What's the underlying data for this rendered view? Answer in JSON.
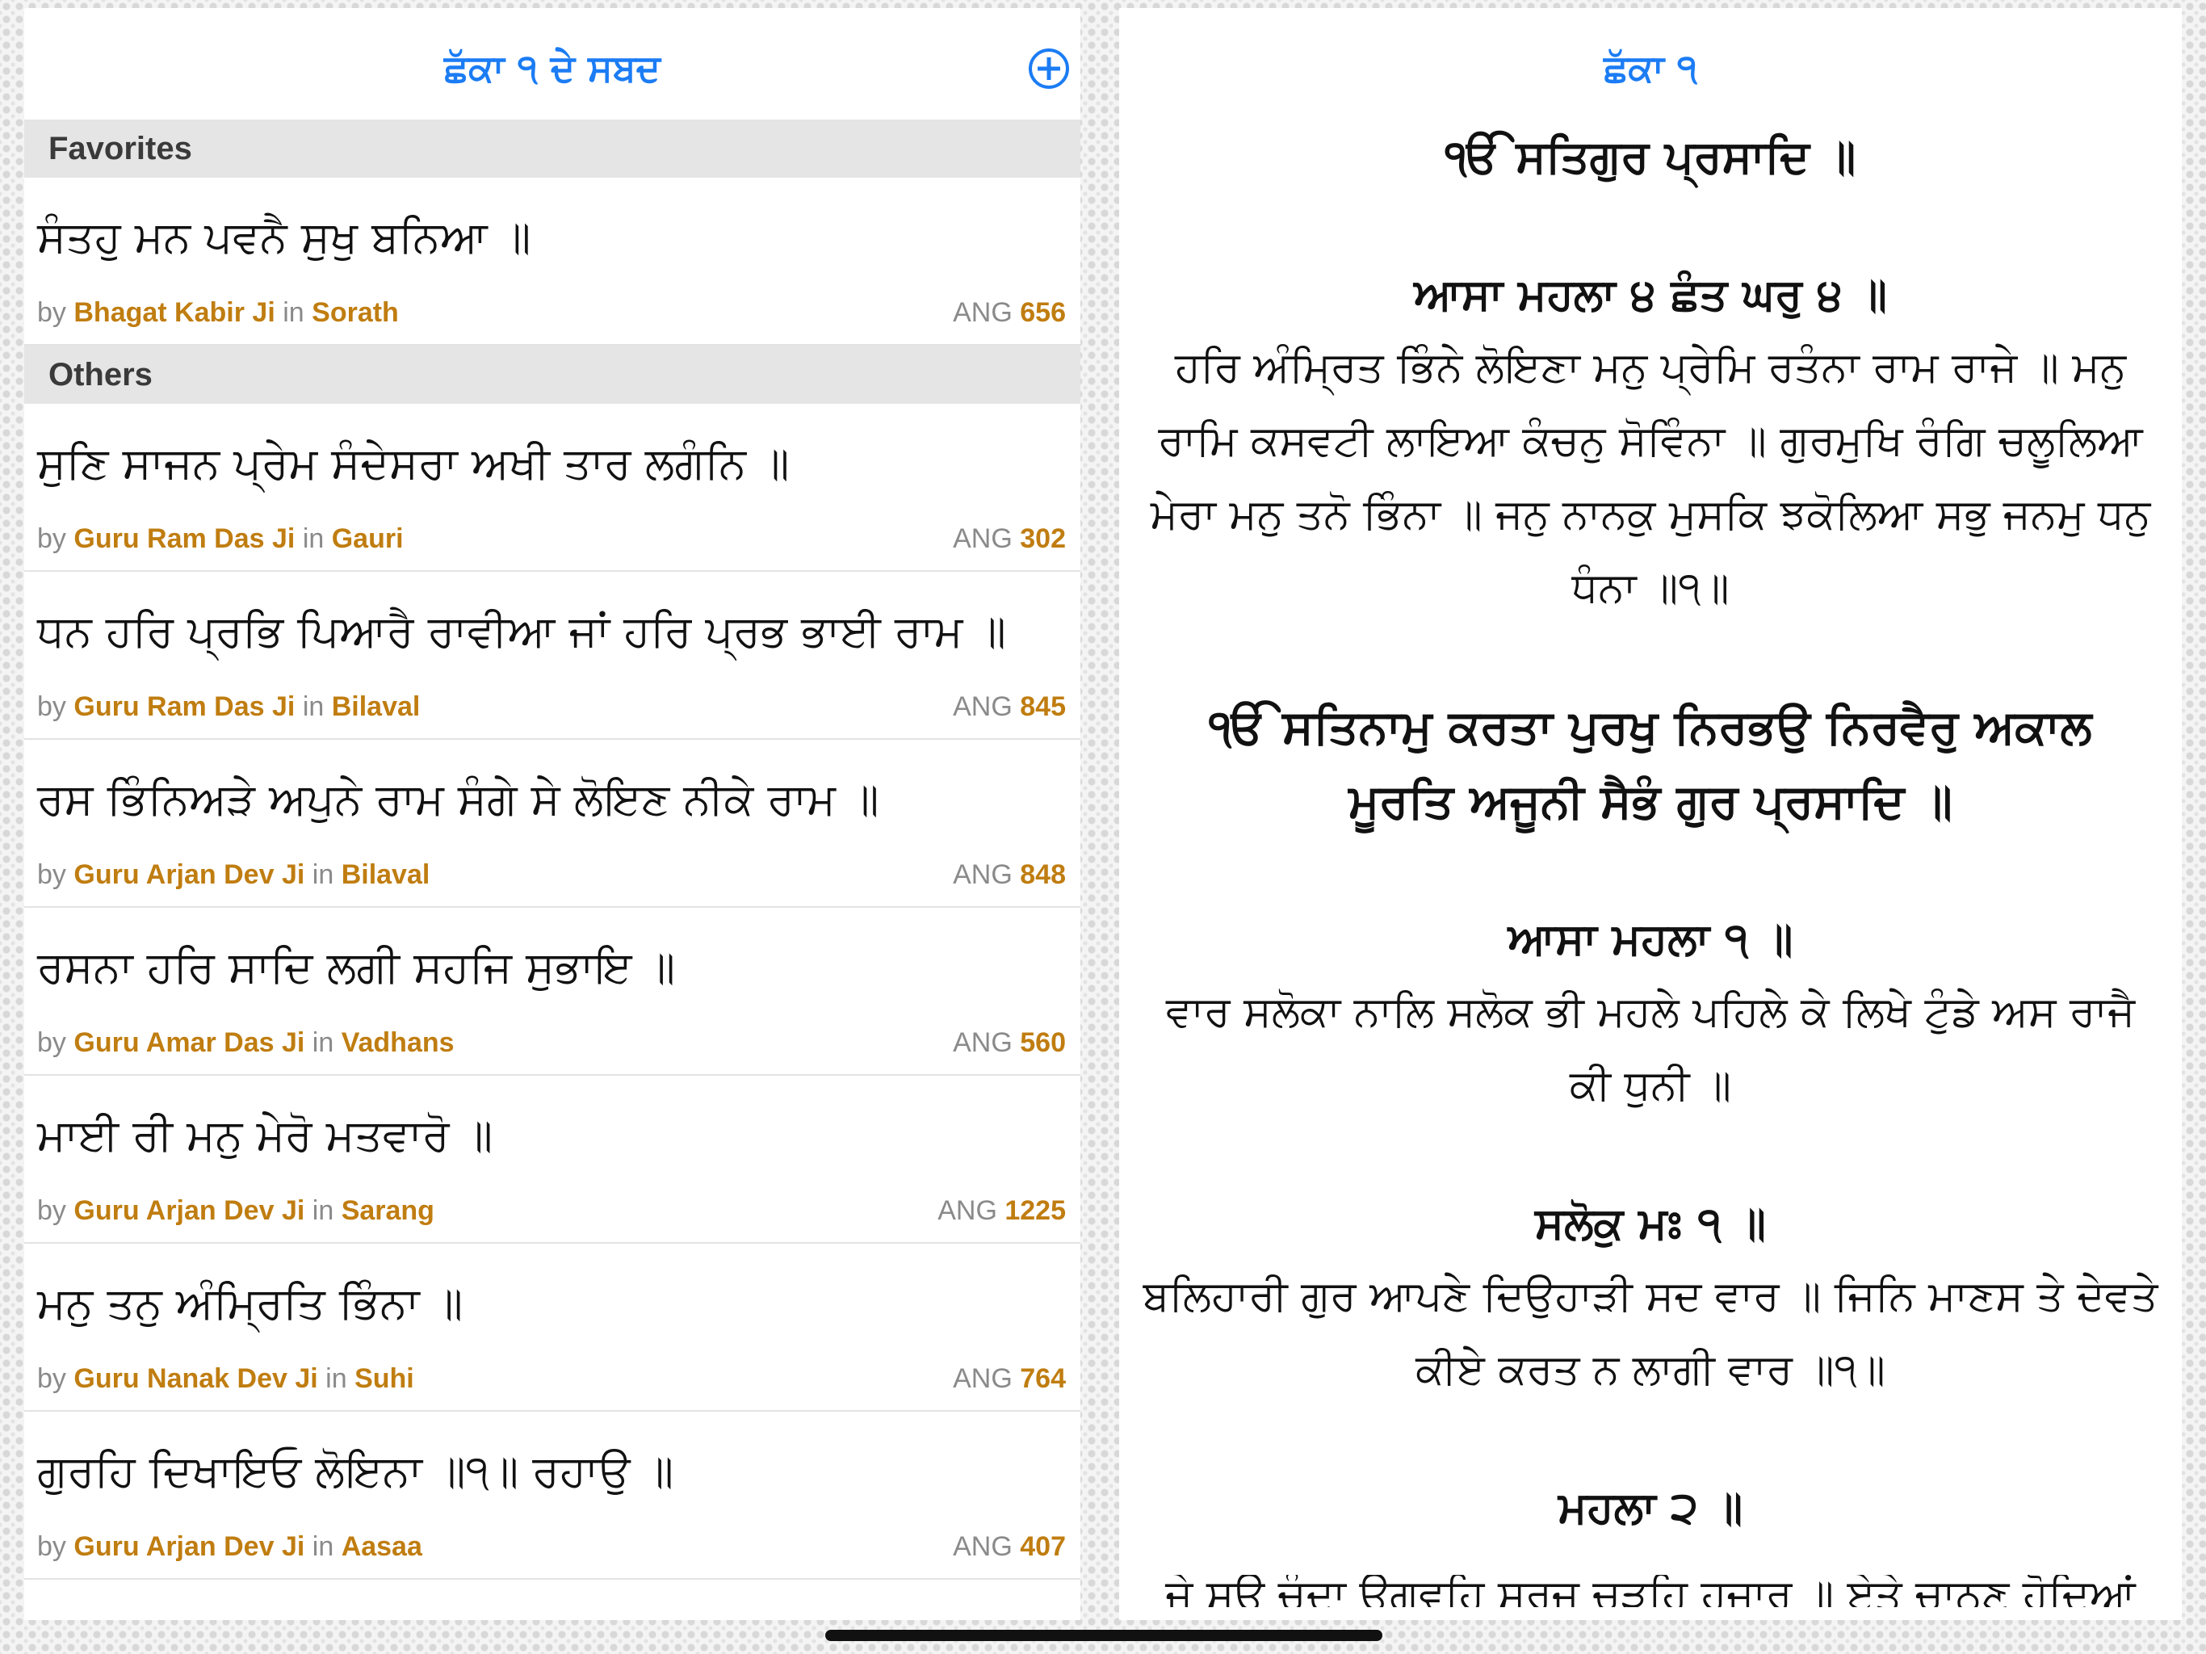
{
  "left": {
    "nav_title": "ਛੱਕਾ ੧ ਦੇ ਸਬਦ",
    "add_icon": "plus-circle-icon",
    "favorites_header": "Favorites",
    "others_header": "Others",
    "by": "by",
    "in": "in",
    "ang": "ANG",
    "favorites": [
      {
        "text": "ਸੰਤਹੁ ਮਨ ਪਵਨੈ ਸੁਖੁ ਬਨਿਆ ॥",
        "author": "Bhagat Kabir Ji",
        "raag": "Sorath",
        "ang": "656"
      }
    ],
    "others": [
      {
        "text": "ਸੁਣਿ ਸਾਜਨ ਪ੍ਰੇਮ ਸੰਦੇਸਰਾ ਅਖੀ ਤਾਰ ਲਗੰਨਿ ॥",
        "author": "Guru Ram Das Ji",
        "raag": "Gauri",
        "ang": "302"
      },
      {
        "text": "ਧਨ ਹਰਿ ਪ੍ਰਭਿ ਪਿਆਰੈ ਰਾਵੀਆ ਜਾਂ ਹਰਿ ਪ੍ਰਭ ਭਾਈ ਰਾਮ ॥",
        "author": "Guru Ram Das Ji",
        "raag": "Bilaval",
        "ang": "845"
      },
      {
        "text": "ਰਸ ਭਿੰਨਿਅੜੇ ਅਪੁਨੇ ਰਾਮ ਸੰਗੇ ਸੇ ਲੋਇਣ ਨੀਕੇ ਰਾਮ ॥",
        "author": "Guru Arjan Dev Ji",
        "raag": "Bilaval",
        "ang": "848"
      },
      {
        "text": "ਰਸਨਾ ਹਰਿ ਸਾਦਿ ਲਗੀ ਸਹਜਿ ਸੁਭਾਇ ॥",
        "author": "Guru Amar Das Ji",
        "raag": "Vadhans",
        "ang": "560"
      },
      {
        "text": "ਮਾਈ ਰੀ ਮਨੁ ਮੇਰੋ ਮਤਵਾਰੋ ॥",
        "author": "Guru Arjan Dev Ji",
        "raag": "Sarang",
        "ang": "1225"
      },
      {
        "text": "ਮਨੁ ਤਨੁ ਅੰਮ੍ਰਿਤਿ ਭਿੰਨਾ ॥",
        "author": "Guru Nanak Dev Ji",
        "raag": "Suhi",
        "ang": "764"
      },
      {
        "text": "ਗੁਰਹਿ ਦਿਖਾਇਓ ਲੋਇਨਾ ॥੧॥ ਰਹਾਉ ॥",
        "author": "Guru Arjan Dev Ji",
        "raag": "Aasaa",
        "ang": "407"
      }
    ]
  },
  "right": {
    "nav_title": "ਛੱਕਾ ੧",
    "line_1": "ੴ ਸਤਿਗੁਰ ਪ੍ਰਸਾਦਿ ॥",
    "heading_1": "ਆਸਾ ਮਹਲਾ ੪ ਛੰਤ ਘਰੁ ੪ ॥",
    "verse_1": "ਹਰਿ ਅੰਮ੍ਰਿਤ ਭਿੰਨੇ ਲੋਇਣਾ ਮਨੁ ਪ੍ਰੇਮਿ ਰਤੰਨਾ ਰਾਮ ਰਾਜੇ ॥ ਮਨੁ ਰਾਮਿ ਕਸਵਟੀ ਲਾਇਆ ਕੰਚਨੁ ਸੋਵਿੰਨਾ ॥ ਗੁਰਮੁਖਿ ਰੰਗਿ ਚਲੂਲਿਆ ਮੇਰਾ ਮਨੁ ਤਨੋ ਭਿੰਨਾ ॥ ਜਨੁ ਨਾਨਕੁ ਮੁਸਕਿ ਝਕੋਲਿਆ ਸਭੁ ਜਨਮੁ ਧਨੁ ਧੰਨਾ ॥੧॥",
    "mool_mantar": "ੴ ਸਤਿਨਾਮੁ ਕਰਤਾ ਪੁਰਖੁ ਨਿਰਭਉ ਨਿਰਵੈਰੁ ਅਕਾਲ ਮੂਰਤਿ ਅਜੂਨੀ ਸੈਭੰ ਗੁਰ ਪ੍ਰਸਾਦਿ ॥",
    "heading_2": "ਆਸਾ ਮਹਲਾ ੧ ॥",
    "verse_2": "ਵਾਰ ਸਲੋਕਾ ਨਾਲਿ ਸਲੋਕ ਭੀ ਮਹਲੇ ਪਹਿਲੇ ਕੇ ਲਿਖੇ ਟੁੰਡੇ ਅਸ ਰਾਜੈ ਕੀ ਧੁਨੀ ॥",
    "heading_3": "ਸਲੋਕੁ ਮਃ ੧ ॥",
    "verse_3": "ਬਲਿਹਾਰੀ ਗੁਰ ਆਪਣੇ ਦਿਉਹਾੜੀ ਸਦ ਵਾਰ ॥ ਜਿਨਿ ਮਾਣਸ ਤੇ ਦੇਵਤੇ ਕੀਏ ਕਰਤ ਨ ਲਾਗੀ ਵਾਰ ॥੧॥",
    "heading_4": "ਮਹਲਾ ੨ ॥",
    "verse_4_partial": "ਜੇ ਸਉ ਚੰਦਾ ਉਗਵਹਿ ਸੂਰਜ ਚੜਹਿ ਹਜਾਰ ॥ ਏਤੇ ਚਾਨਣ ਹੋਦਿਆਂ"
  },
  "colors": {
    "accent": "#1b7cf4",
    "highlight": "#c07d10",
    "meta_gray": "#8a8a8a",
    "section_bg": "#e5e5e5"
  }
}
